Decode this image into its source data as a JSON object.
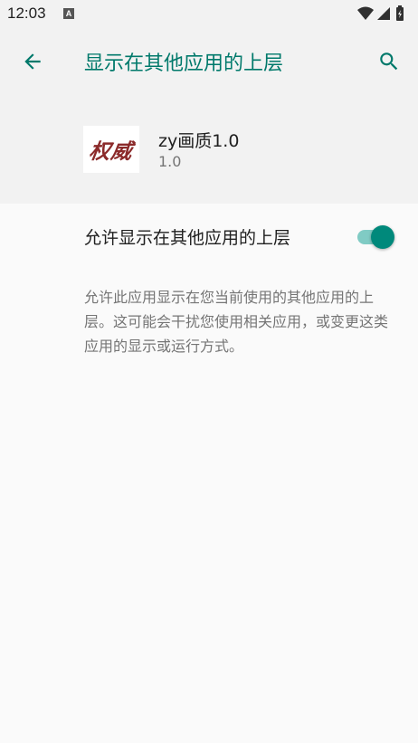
{
  "status_bar": {
    "time": "12:03",
    "notification_icon": "A"
  },
  "toolbar": {
    "title": "显示在其他应用的上层",
    "back_icon": "arrow-back-icon",
    "search_icon": "search-icon"
  },
  "app": {
    "icon_text": "权威",
    "name": "zy画质1.0",
    "version": "1.0"
  },
  "permission": {
    "label": "允许显示在其他应用的上层",
    "enabled": true,
    "description": "允许此应用显示在您当前使用的其他应用的上层。这可能会干扰您使用相关应用，或变更这类应用的显示或运行方式。"
  },
  "colors": {
    "accent": "#00796b",
    "switch_thumb": "#00897b",
    "switch_track": "#80cbc4",
    "header_bg": "#f2f2f2",
    "page_bg": "#fafafa"
  }
}
